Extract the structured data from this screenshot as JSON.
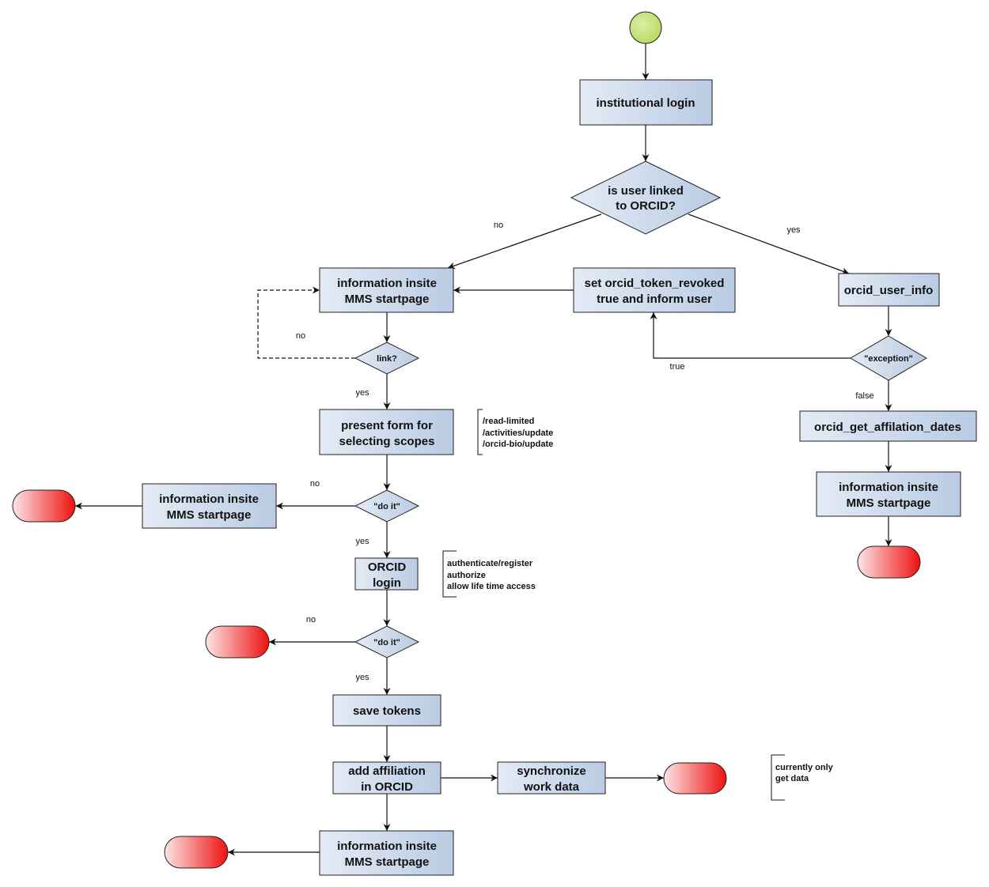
{
  "colors": {
    "start": "#c6e27a",
    "box_light": "#e4ebf5",
    "box_dark": "#b9cbe3",
    "end_light": "#fde4e4",
    "end_dark": "#ee1111"
  },
  "nodes": {
    "institutional_login": "institutional login",
    "linked_decision": [
      "is user linked",
      "to ORCID?"
    ],
    "info_top": [
      "information insite",
      "MMS startpage"
    ],
    "revoke": [
      "set orcid_token_revoked",
      "true and inform user"
    ],
    "orcid_user_info": "orcid_user_info",
    "exception": "\"exception\"",
    "link": "link?",
    "present_form": [
      "present form for",
      "selecting scopes"
    ],
    "do_it_1": "\"do it\"",
    "info_left": [
      "information insite",
      "MMS startpage"
    ],
    "orcid_login": [
      "ORCID",
      "login"
    ],
    "do_it_2": "\"do it\"",
    "save_tokens": "save tokens",
    "add_affiliation": [
      "add affiliation",
      "in ORCID"
    ],
    "synchronize": [
      "synchronize",
      "work data"
    ],
    "info_bottom": [
      "information insite",
      "MMS startpage"
    ],
    "get_affiliation_dates": "orcid_get_affilation_dates",
    "info_right": [
      "information insite",
      "MMS startpage"
    ]
  },
  "edge_labels": {
    "no1": "no",
    "yes1": "yes",
    "no_link": "no",
    "yes_link": "yes",
    "no_do1": "no",
    "yes_do1": "yes",
    "no_do2": "no",
    "yes_do2": "yes",
    "true": "true",
    "false": "false"
  },
  "notes": {
    "scopes": [
      "/read-limited",
      "/activities/update",
      "/orcid-bio/update"
    ],
    "orcid_login": [
      "authenticate/register",
      "authorize",
      "allow life time access"
    ],
    "sync": [
      "currently only",
      "get data"
    ]
  }
}
